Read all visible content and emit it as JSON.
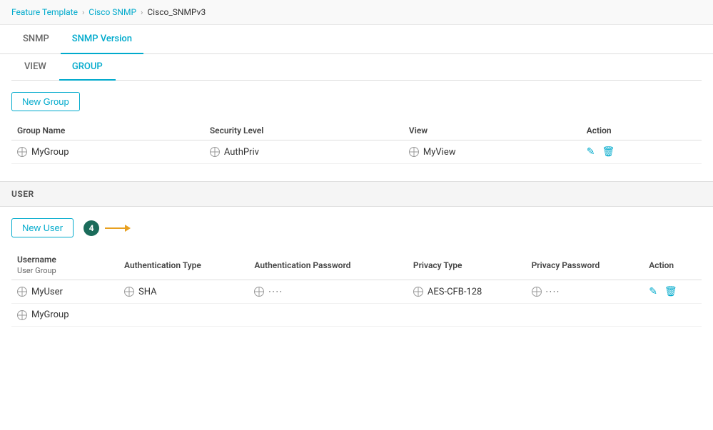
{
  "breadcrumb": {
    "items": [
      "Feature Template",
      "Cisco SNMP",
      "Cisco_SNMPv3"
    ]
  },
  "topTabs": {
    "tabs": [
      "SNMP",
      "SNMP Version"
    ],
    "activeTab": "SNMP Version"
  },
  "subTabs": {
    "tabs": [
      "VIEW",
      "GROUP"
    ],
    "activeTab": "GROUP"
  },
  "newGroupButton": "New Group",
  "groupTable": {
    "headers": [
      "Group Name",
      "Security Level",
      "View",
      "Action"
    ],
    "rows": [
      {
        "groupName": "MyGroup",
        "securityLevel": "AuthPriv",
        "view": "MyView"
      }
    ]
  },
  "userSection": {
    "title": "USER",
    "newUserButton": "New User",
    "badge": "4",
    "tableHeaders": {
      "username": "Username",
      "userGroup": "User Group",
      "authType": "Authentication Type",
      "authPassword": "Authentication Password",
      "privacyType": "Privacy Type",
      "privacyPassword": "Privacy Password",
      "action": "Action"
    },
    "rows": [
      {
        "username": "MyUser",
        "authType": "SHA",
        "authPassword": "····",
        "privacyType": "AES-CFB-128",
        "privacyPassword": "····"
      },
      {
        "userGroup": "MyGroup"
      }
    ]
  },
  "icons": {
    "edit": "✎",
    "delete": "🗑",
    "chevron": "›"
  }
}
